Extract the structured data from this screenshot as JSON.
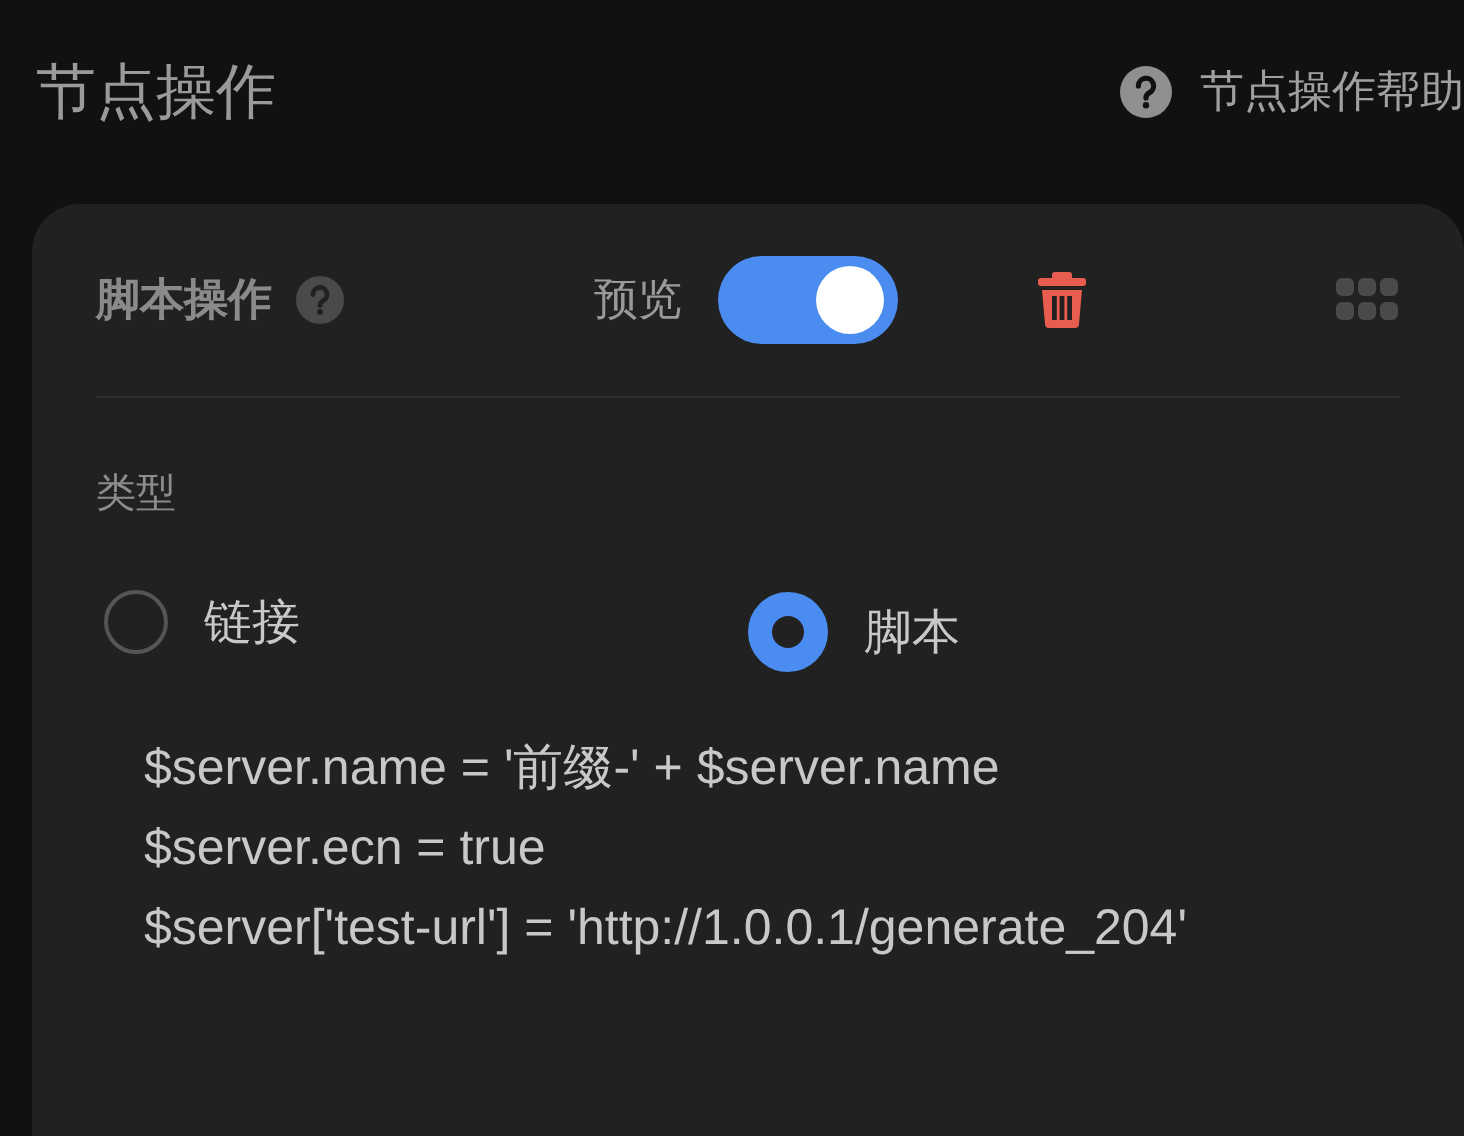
{
  "page": {
    "title": "节点操作",
    "help_link": "节点操作帮助"
  },
  "card": {
    "title": "脚本操作",
    "preview": {
      "label": "预览",
      "on": true
    },
    "type_label": "类型",
    "options": [
      {
        "label": "链接",
        "selected": false
      },
      {
        "label": "脚本",
        "selected": true
      }
    ],
    "script_lines": [
      "$server.name = '前缀-' + $server.name",
      "$server.ecn = true",
      "$server['test-url'] = 'http://1.0.0.1/generate_204'"
    ]
  }
}
